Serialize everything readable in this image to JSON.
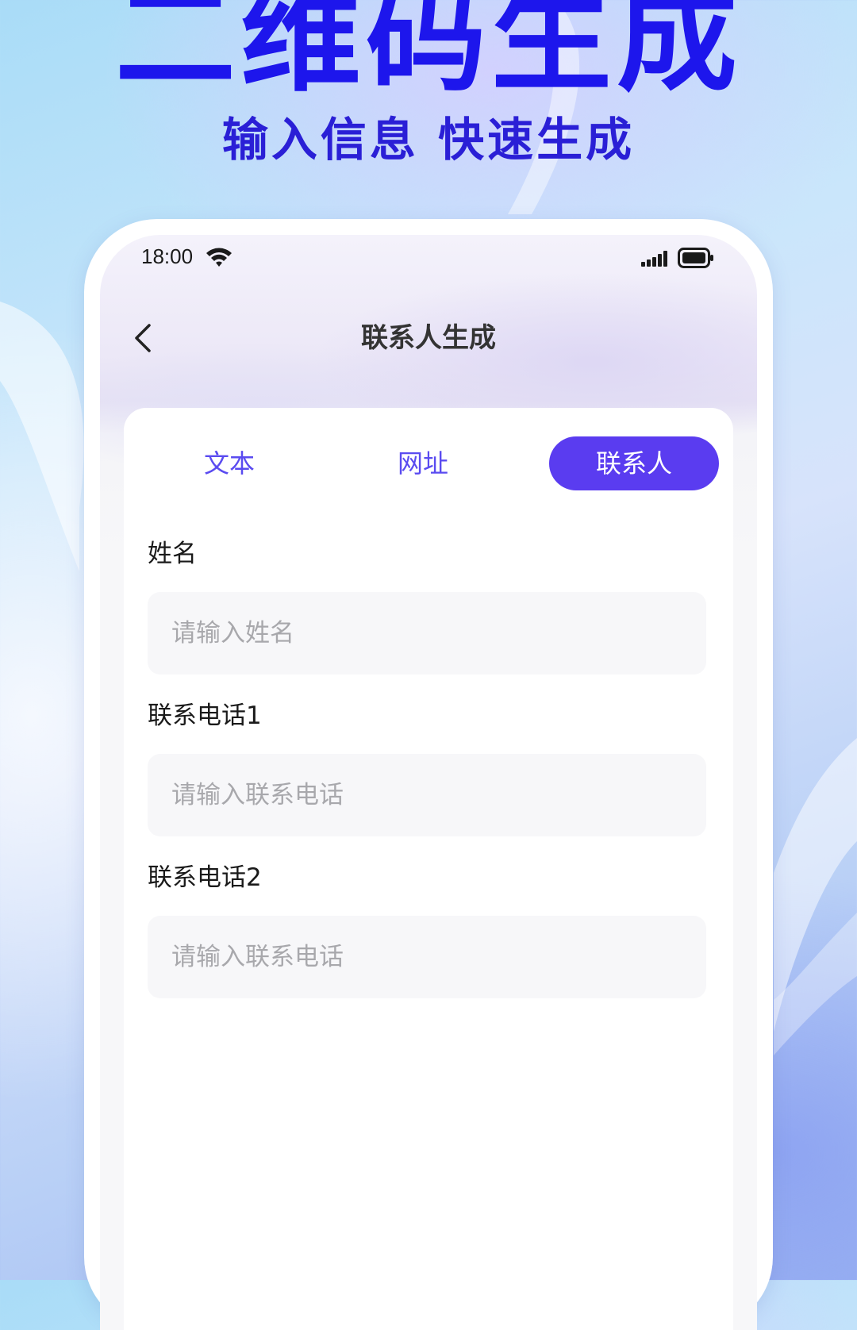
{
  "hero": {
    "title": "二维码生成",
    "subtitle": "输入信息 快速生成"
  },
  "status_bar": {
    "time": "18:00",
    "icons": [
      "wifi-icon",
      "signal-icon",
      "battery-icon"
    ]
  },
  "nav": {
    "back_icon": "chevron-left-icon",
    "title": "联系人生成"
  },
  "tabs": [
    {
      "label": "文本",
      "selected": false
    },
    {
      "label": "网址",
      "selected": false
    },
    {
      "label": "联系人",
      "selected": true
    }
  ],
  "form": {
    "fields": [
      {
        "label": "姓名",
        "placeholder": "请输入姓名",
        "value": ""
      },
      {
        "label": "联系电话1",
        "placeholder": "请输入联系电话",
        "value": ""
      },
      {
        "label": "联系电话2",
        "placeholder": "请输入联系电话",
        "value": ""
      }
    ]
  },
  "colors": {
    "hero_title": "#1d16ec",
    "accent": "#5a3cf0",
    "tab_text": "#5a4bf0",
    "input_bg": "#f7f7f9",
    "placeholder": "#a8a8ac"
  }
}
